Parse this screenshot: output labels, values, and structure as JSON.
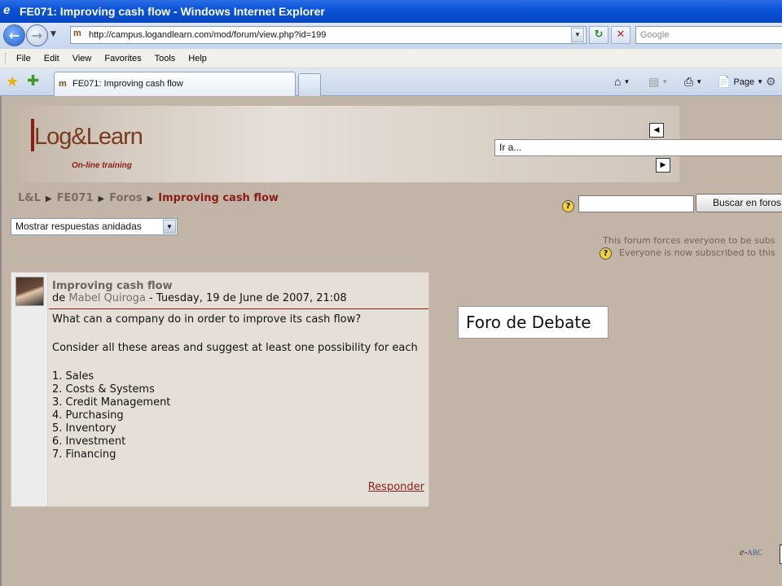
{
  "window": {
    "title": "FE071: Improving cash flow - Windows Internet Explorer",
    "url": "http://campus.logandlearn.com/mod/forum/view.php?id=199",
    "search_placeholder": "Google",
    "tab_title": "FE071: Improving cash flow"
  },
  "menu": [
    "File",
    "Edit",
    "View",
    "Favorites",
    "Tools",
    "Help"
  ],
  "command_bar": {
    "page_label": "Page"
  },
  "site": {
    "logo_text": "Log&Learn",
    "logo_tagline": "On-line training",
    "goto_value": "Ir a...",
    "search_button": "Buscar en foros"
  },
  "breadcrumb": {
    "items": [
      "L&L",
      "FE071",
      "Foros"
    ],
    "current": "Improving cash flow"
  },
  "display_mode": "Mostrar respuestas anidadas",
  "subscription": {
    "line1": "This forum forces everyone to be subs",
    "line2": "Everyone is now subscribed to this"
  },
  "post": {
    "subject": "Improving cash flow",
    "by_prefix": "de",
    "author": "Mabel Quiroga",
    "date": "- Tuesday, 19 de June de 2007, 21:08",
    "question": "What can a company do in order to improve its cash flow?",
    "instruction": "Consider all these areas and suggest at least one possibility for each",
    "areas": [
      "1. Sales",
      "2. Costs & Systems",
      "3. Credit Management",
      "4. Purchasing",
      "5. Inventory",
      "6. Investment",
      "7. Financing"
    ],
    "reply_label": "Responder"
  },
  "callout": "Foro de Debate",
  "footer": {
    "brand_prefix": "e-",
    "brand_suffix": "ABC"
  }
}
